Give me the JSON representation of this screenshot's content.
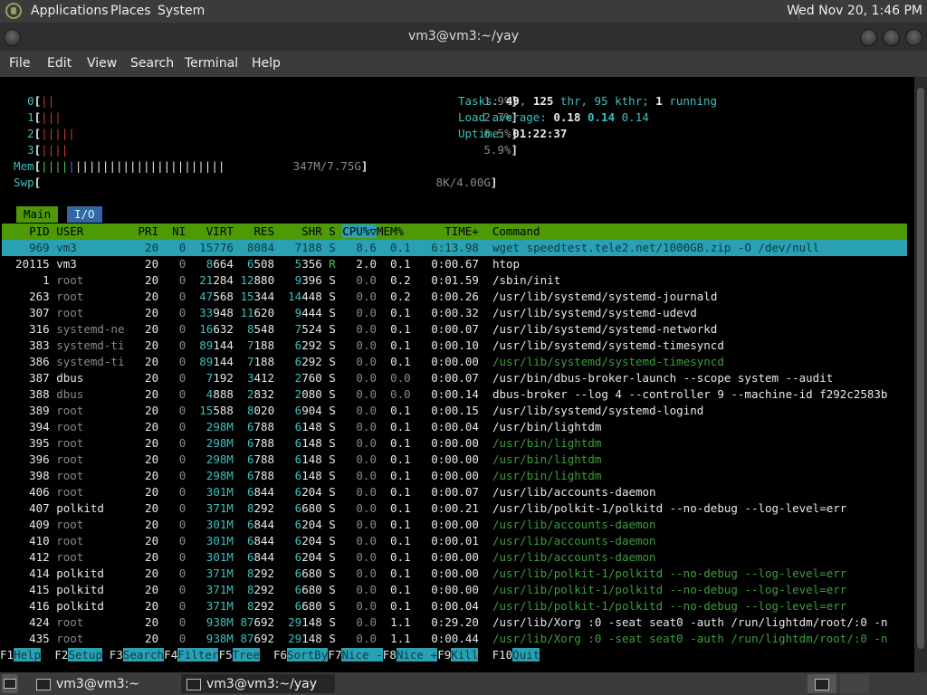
{
  "topbar": {
    "menus": [
      "Applications",
      "Places",
      "System"
    ],
    "clock": "Wed Nov 20,  1:46 PM"
  },
  "window": {
    "title": "vm3@vm3:~/yay"
  },
  "menubar": [
    "File",
    "Edit",
    "View",
    "Search",
    "Terminal",
    "Help"
  ],
  "htop": {
    "cpus": [
      {
        "id": "0",
        "bars": "||",
        "pct": "1.9%"
      },
      {
        "id": "1",
        "bars": "|||",
        "pct": "2.7%"
      },
      {
        "id": "2",
        "bars": "|||||",
        "pct": "6.5%"
      },
      {
        "id": "3",
        "bars": "||||",
        "pct": "5.9%"
      }
    ],
    "mem": {
      "label": "Mem",
      "bars_a": "||||",
      "bars_b": "||||||||||||||||||||||",
      "value": "347M/7.75G"
    },
    "swp": {
      "label": "Swp",
      "value": "8K/4.00G"
    },
    "tasks": {
      "label": "Tasks:",
      "count": "49",
      "thr": "125",
      "thr_label": "thr,",
      "kthr": "95 kthr;",
      "running": "1",
      "running_label": "running"
    },
    "load": {
      "label": "Load average:",
      "l1": "0.18",
      "l5": "0.14",
      "l15": "0.14"
    },
    "uptime": {
      "label": "Uptime:",
      "value": "01:22:37"
    },
    "tabs": [
      "Main",
      "I/O"
    ],
    "columns": {
      "pid": "PID",
      "user": "USER",
      "pri": "PRI",
      "ni": "NI",
      "virt": "VIRT",
      "res": "RES",
      "shr": "SHR",
      "s": "S",
      "cpu": "CPU%▽",
      "mem": "MEM%",
      "time": "TIME+",
      "cmd": "Command"
    },
    "processes": [
      {
        "pid": "969",
        "user": "vm3",
        "pri": "20",
        "ni": "0",
        "virt": "15776",
        "res": "8084",
        "shr": "7188",
        "s": "S",
        "cpu": "8.6",
        "mem": "0.1",
        "time": "6:13.98",
        "cmd": "wget speedtest.tele2.net/1000GB.zip -O /dev/null",
        "sel": true
      },
      {
        "pid": "20115",
        "user": "vm3",
        "pri": "20",
        "ni": "0",
        "virt": "8664",
        "res": "6508",
        "shr": "5356",
        "s": "R",
        "cpu": "2.0",
        "mem": "0.1",
        "time": "0:00.67",
        "cmd": "htop"
      },
      {
        "pid": "1",
        "user": "root",
        "pri": "20",
        "ni": "0",
        "virt": "21284",
        "res": "12880",
        "shr": "9396",
        "s": "S",
        "cpu": "0.0",
        "mem": "0.2",
        "time": "0:01.59",
        "cmd": "/sbin/init"
      },
      {
        "pid": "263",
        "user": "root",
        "pri": "20",
        "ni": "0",
        "virt": "47568",
        "res": "15344",
        "shr": "14448",
        "s": "S",
        "cpu": "0.0",
        "mem": "0.2",
        "time": "0:00.26",
        "cmd": "/usr/lib/systemd/systemd-journald"
      },
      {
        "pid": "307",
        "user": "root",
        "pri": "20",
        "ni": "0",
        "virt": "33948",
        "res": "11620",
        "shr": "9444",
        "s": "S",
        "cpu": "0.0",
        "mem": "0.1",
        "time": "0:00.32",
        "cmd": "/usr/lib/systemd/systemd-udevd"
      },
      {
        "pid": "316",
        "user": "systemd-ne",
        "pri": "20",
        "ni": "0",
        "virt": "16632",
        "res": "8548",
        "shr": "7524",
        "s": "S",
        "cpu": "0.0",
        "mem": "0.1",
        "time": "0:00.07",
        "cmd": "/usr/lib/systemd/systemd-networkd",
        "ugray": true
      },
      {
        "pid": "383",
        "user": "systemd-ti",
        "pri": "20",
        "ni": "0",
        "virt": "89144",
        "res": "7188",
        "shr": "6292",
        "s": "S",
        "cpu": "0.0",
        "mem": "0.1",
        "time": "0:00.10",
        "cmd": "/usr/lib/systemd/systemd-timesyncd",
        "ugray": true
      },
      {
        "pid": "386",
        "user": "systemd-ti",
        "pri": "20",
        "ni": "0",
        "virt": "89144",
        "res": "7188",
        "shr": "6292",
        "s": "S",
        "cpu": "0.0",
        "mem": "0.1",
        "time": "0:00.00",
        "cmd": "/usr/lib/systemd/systemd-timesyncd",
        "ugray": true,
        "thread": true
      },
      {
        "pid": "387",
        "user": "dbus",
        "pri": "20",
        "ni": "0",
        "virt": "7192",
        "res": "3412",
        "shr": "2760",
        "s": "S",
        "cpu": "0.0",
        "mem": "0.0",
        "time": "0:00.07",
        "cmd": "/usr/bin/dbus-broker-launch --scope system --audit"
      },
      {
        "pid": "388",
        "user": "dbus",
        "pri": "20",
        "ni": "0",
        "virt": "4888",
        "res": "2832",
        "shr": "2080",
        "s": "S",
        "cpu": "0.0",
        "mem": "0.0",
        "time": "0:00.14",
        "cmd": "dbus-broker --log 4 --controller 9 --machine-id f292c2583b",
        "ugray": true
      },
      {
        "pid": "389",
        "user": "root",
        "pri": "20",
        "ni": "0",
        "virt": "15588",
        "res": "8020",
        "shr": "6904",
        "s": "S",
        "cpu": "0.0",
        "mem": "0.1",
        "time": "0:00.15",
        "cmd": "/usr/lib/systemd/systemd-logind"
      },
      {
        "pid": "394",
        "user": "root",
        "pri": "20",
        "ni": "0",
        "virt": "298M",
        "res": "6788",
        "shr": "6148",
        "s": "S",
        "cpu": "0.0",
        "mem": "0.1",
        "time": "0:00.04",
        "cmd": "/usr/bin/lightdm"
      },
      {
        "pid": "395",
        "user": "root",
        "pri": "20",
        "ni": "0",
        "virt": "298M",
        "res": "6788",
        "shr": "6148",
        "s": "S",
        "cpu": "0.0",
        "mem": "0.1",
        "time": "0:00.00",
        "cmd": "/usr/bin/lightdm",
        "thread": true
      },
      {
        "pid": "396",
        "user": "root",
        "pri": "20",
        "ni": "0",
        "virt": "298M",
        "res": "6788",
        "shr": "6148",
        "s": "S",
        "cpu": "0.0",
        "mem": "0.1",
        "time": "0:00.00",
        "cmd": "/usr/bin/lightdm",
        "thread": true
      },
      {
        "pid": "398",
        "user": "root",
        "pri": "20",
        "ni": "0",
        "virt": "298M",
        "res": "6788",
        "shr": "6148",
        "s": "S",
        "cpu": "0.0",
        "mem": "0.1",
        "time": "0:00.00",
        "cmd": "/usr/bin/lightdm",
        "thread": true
      },
      {
        "pid": "406",
        "user": "root",
        "pri": "20",
        "ni": "0",
        "virt": "301M",
        "res": "6844",
        "shr": "6204",
        "s": "S",
        "cpu": "0.0",
        "mem": "0.1",
        "time": "0:00.07",
        "cmd": "/usr/lib/accounts-daemon"
      },
      {
        "pid": "407",
        "user": "polkitd",
        "pri": "20",
        "ni": "0",
        "virt": "371M",
        "res": "8292",
        "shr": "6680",
        "s": "S",
        "cpu": "0.0",
        "mem": "0.1",
        "time": "0:00.21",
        "cmd": "/usr/lib/polkit-1/polkitd --no-debug --log-level=err"
      },
      {
        "pid": "409",
        "user": "root",
        "pri": "20",
        "ni": "0",
        "virt": "301M",
        "res": "6844",
        "shr": "6204",
        "s": "S",
        "cpu": "0.0",
        "mem": "0.1",
        "time": "0:00.00",
        "cmd": "/usr/lib/accounts-daemon",
        "thread": true
      },
      {
        "pid": "410",
        "user": "root",
        "pri": "20",
        "ni": "0",
        "virt": "301M",
        "res": "6844",
        "shr": "6204",
        "s": "S",
        "cpu": "0.0",
        "mem": "0.1",
        "time": "0:00.01",
        "cmd": "/usr/lib/accounts-daemon",
        "thread": true
      },
      {
        "pid": "412",
        "user": "root",
        "pri": "20",
        "ni": "0",
        "virt": "301M",
        "res": "6844",
        "shr": "6204",
        "s": "S",
        "cpu": "0.0",
        "mem": "0.1",
        "time": "0:00.00",
        "cmd": "/usr/lib/accounts-daemon",
        "thread": true
      },
      {
        "pid": "414",
        "user": "polkitd",
        "pri": "20",
        "ni": "0",
        "virt": "371M",
        "res": "8292",
        "shr": "6680",
        "s": "S",
        "cpu": "0.0",
        "mem": "0.1",
        "time": "0:00.00",
        "cmd": "/usr/lib/polkit-1/polkitd --no-debug --log-level=err",
        "thread": true
      },
      {
        "pid": "415",
        "user": "polkitd",
        "pri": "20",
        "ni": "0",
        "virt": "371M",
        "res": "8292",
        "shr": "6680",
        "s": "S",
        "cpu": "0.0",
        "mem": "0.1",
        "time": "0:00.00",
        "cmd": "/usr/lib/polkit-1/polkitd --no-debug --log-level=err",
        "thread": true
      },
      {
        "pid": "416",
        "user": "polkitd",
        "pri": "20",
        "ni": "0",
        "virt": "371M",
        "res": "8292",
        "shr": "6680",
        "s": "S",
        "cpu": "0.0",
        "mem": "0.1",
        "time": "0:00.04",
        "cmd": "/usr/lib/polkit-1/polkitd --no-debug --log-level=err",
        "thread": true
      },
      {
        "pid": "424",
        "user": "root",
        "pri": "20",
        "ni": "0",
        "virt": "938M",
        "res": "87692",
        "shr": "29148",
        "s": "S",
        "cpu": "0.0",
        "mem": "1.1",
        "time": "0:29.20",
        "cmd": "/usr/lib/Xorg :0 -seat seat0 -auth /run/lightdm/root/:0 -n"
      },
      {
        "pid": "435",
        "user": "root",
        "pri": "20",
        "ni": "0",
        "virt": "938M",
        "res": "87692",
        "shr": "29148",
        "s": "S",
        "cpu": "0.0",
        "mem": "1.1",
        "time": "0:00.44",
        "cmd": "/usr/lib/Xorg :0 -seat seat0 -auth /run/lightdm/root/:0 -n",
        "thread": true
      }
    ],
    "fkeys": [
      {
        "k": "F1",
        "l": "Help  "
      },
      {
        "k": "F2",
        "l": "Setup "
      },
      {
        "k": "F3",
        "l": "Search"
      },
      {
        "k": "F4",
        "l": "Filter"
      },
      {
        "k": "F5",
        "l": "Tree  "
      },
      {
        "k": "F6",
        "l": "SortBy"
      },
      {
        "k": "F7",
        "l": "Nice -"
      },
      {
        "k": "F8",
        "l": "Nice +"
      },
      {
        "k": "F9",
        "l": "Kill  "
      },
      {
        "k": "F10",
        "l": "Quit                                                      "
      }
    ]
  },
  "taskbar": {
    "items": [
      "vm3@vm3:~",
      "vm3@vm3:~/yay"
    ]
  },
  "colors": {
    "panel": "#3b3b3b",
    "header_green": "#4e9a06",
    "selection_cyan": "#2aa1b3",
    "tab_blue": "#3465a4"
  }
}
